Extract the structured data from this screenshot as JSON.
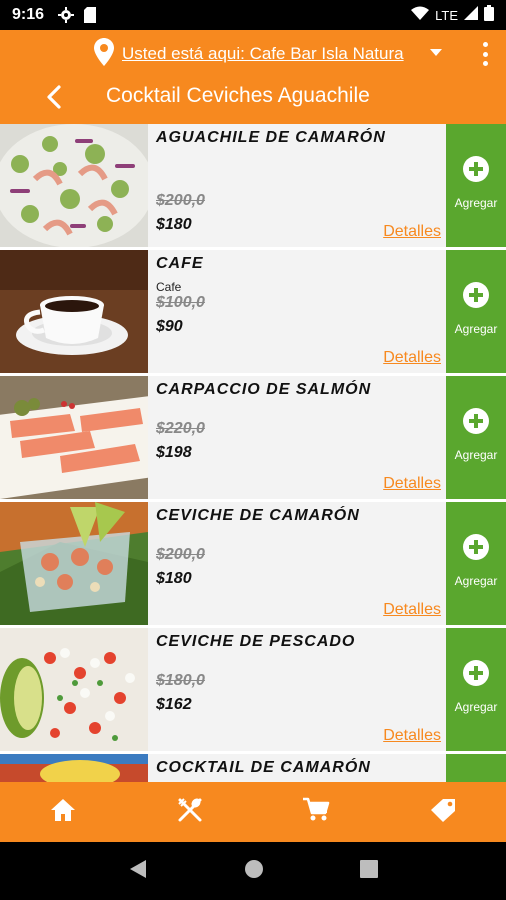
{
  "status_bar": {
    "time": "9:16",
    "network": "LTE"
  },
  "header": {
    "location_text": "Usted está aqui: Cafe Bar Isla Natura",
    "title": "Cocktail Ceviches Aguachile"
  },
  "items": [
    {
      "name": "Aguachile de Camarón",
      "subtitle": "",
      "old_price": "$200,0",
      "price": "$180",
      "details_label": "Detalles",
      "add_label": "Agregar"
    },
    {
      "name": "Cafe",
      "subtitle": "Cafe",
      "old_price": "$100,0",
      "price": "$90",
      "details_label": "Detalles",
      "add_label": "Agregar"
    },
    {
      "name": "Carpaccio de Salmón",
      "subtitle": "",
      "old_price": "$220,0",
      "price": "$198",
      "details_label": "Detalles",
      "add_label": "Agregar"
    },
    {
      "name": "Ceviche de Camarón",
      "subtitle": "",
      "old_price": "$200,0",
      "price": "$180",
      "details_label": "Detalles",
      "add_label": "Agregar"
    },
    {
      "name": "Ceviche de Pescado",
      "subtitle": "",
      "old_price": "$180,0",
      "price": "$162",
      "details_label": "Detalles",
      "add_label": "Agregar"
    },
    {
      "name": "Cocktail de Camarón",
      "subtitle": "",
      "old_price": "",
      "price": "",
      "details_label": "",
      "add_label": ""
    }
  ],
  "bottom_nav": [
    {
      "icon": "home-icon"
    },
    {
      "icon": "utensils-icon"
    },
    {
      "icon": "cart-icon"
    },
    {
      "icon": "tag-icon"
    }
  ],
  "colors": {
    "primary": "#F7891F",
    "add": "#5AA72E",
    "strike": "#888888"
  }
}
